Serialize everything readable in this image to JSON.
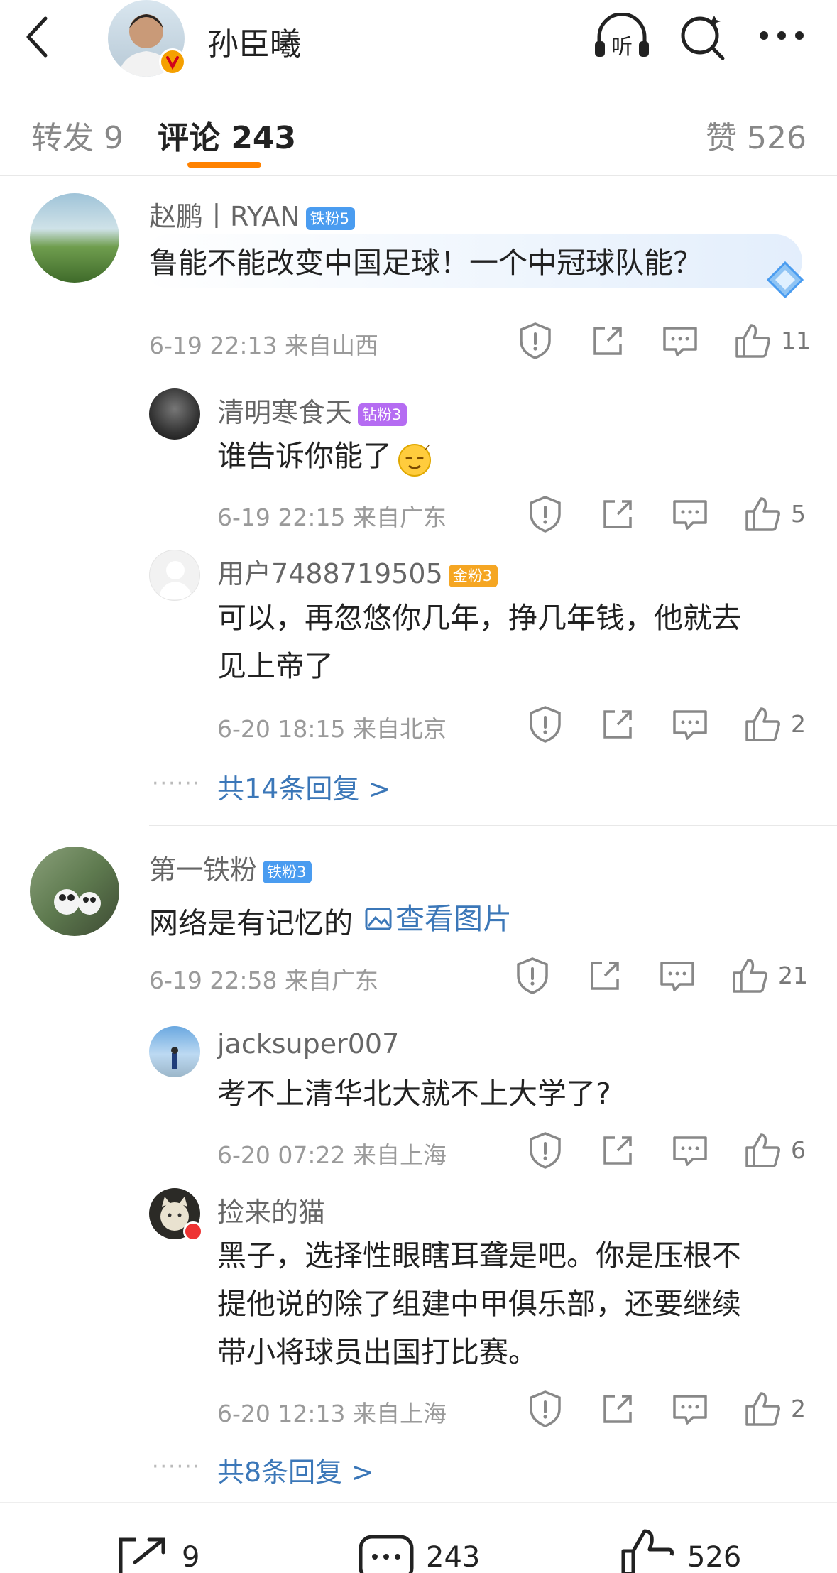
{
  "header": {
    "title": "孙臣曦",
    "listen_label": "听"
  },
  "tabs": {
    "repost": "转发 9",
    "comments": "评论 243",
    "likes": "赞 526"
  },
  "comments": [
    {
      "name": "赵鹏丨RYAN",
      "badge": "铁粉5",
      "text": "鲁能不能改变中国足球！一个中冠球队能？",
      "time": "6-19 22:13",
      "location": "来自山西",
      "likes": "11",
      "replies": [
        {
          "name": "清明寒食天",
          "badge": "钻粉3",
          "text": "谁告诉你能了",
          "time": "6-19 22:15",
          "location": "来自广东",
          "likes": "5"
        },
        {
          "name": "用户7488719505",
          "badge": "金粉3",
          "text_line1": "可以，再忽悠你几年，挣几年钱，他就去",
          "text_line2": "见上帝了",
          "time": "6-20 18:15",
          "location": "来自北京",
          "likes": "2"
        }
      ],
      "more": "共14条回复 >"
    },
    {
      "name": "第一铁粉",
      "badge": "铁粉3",
      "text": "网络是有记忆的",
      "link": "查看图片",
      "time": "6-19 22:58",
      "location": "来自广东",
      "likes": "21",
      "replies": [
        {
          "name": "jacksuper007",
          "text": "考不上清华北大就不上大学了?",
          "time": "6-20 07:22",
          "location": "来自上海",
          "likes": "6"
        },
        {
          "name": "捡来的猫",
          "text_line1": "黑子，选择性眼瞎耳聋是吧。你是压根不",
          "text_line2": "提他说的除了组建中甲俱乐部，还要继续",
          "text_line3": "带小将球员出国打比赛。",
          "time": "6-20 12:13",
          "location": "来自上海",
          "likes": "2"
        }
      ],
      "more": "共8条回复 >"
    }
  ],
  "bottom_bar": {
    "reposts": "9",
    "comments": "243",
    "likes": "526"
  },
  "colors": {
    "accent": "#ff8200",
    "link": "#3b77b8",
    "iron_badge": "#4a9cf0",
    "diamond_badge": "#b56cf2",
    "gold_badge": "#f5a623"
  },
  "icons": [
    "back-icon",
    "headphones-icon",
    "search-icon",
    "more-icon",
    "report-icon",
    "share-icon",
    "reply-icon",
    "like-icon",
    "image-icon",
    "repost-icon",
    "comment-icon"
  ]
}
